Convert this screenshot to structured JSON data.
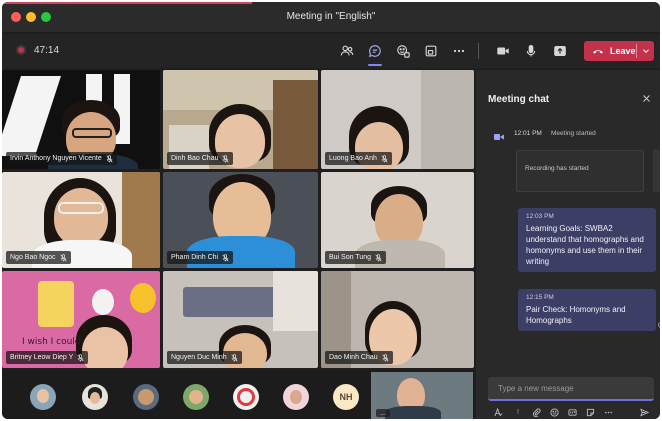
{
  "window": {
    "title": "Meeting in \"English\""
  },
  "toolbar": {
    "timer": "47:14",
    "leave_label": "Leave",
    "icons": [
      "participants-icon",
      "chat-icon",
      "reactions-icon",
      "rooms-icon",
      "more-icon",
      "camera-icon",
      "mic-icon",
      "share-icon"
    ]
  },
  "participants": [
    {
      "name": "Irvin Anthony Nguyen Vicente"
    },
    {
      "name": "Dinh Bao Chau"
    },
    {
      "name": "Luong Bao Anh"
    },
    {
      "name": "Ngo Bao Ngoc"
    },
    {
      "name": "Pham Dinh Chi"
    },
    {
      "name": "Bui Son Tung"
    },
    {
      "name": "Britney Leow Diep Y"
    },
    {
      "name": "Nguyen Duc Minh"
    },
    {
      "name": "Dao Minh Chau"
    }
  ],
  "tile_overlay_text": "I wish I could",
  "strip": {
    "initials": "NH",
    "more": "..."
  },
  "chat": {
    "title": "Meeting chat",
    "system": {
      "time": "12:01 PM",
      "text": "Meeting started"
    },
    "recording_card": "Recording has started",
    "messages": [
      {
        "time": "12:03 PM",
        "text": "Learning Goals: SWBA2 understand that homographs and homonyms and use them in their writing"
      },
      {
        "time": "12:15 PM",
        "text": "Pair Check: Homonyms and Homographs"
      }
    ],
    "compose_placeholder": "Type a new message"
  },
  "colors": {
    "accent": "#7f85f5",
    "leave": "#c4314b",
    "chat_bubble": "#3d3e66"
  }
}
